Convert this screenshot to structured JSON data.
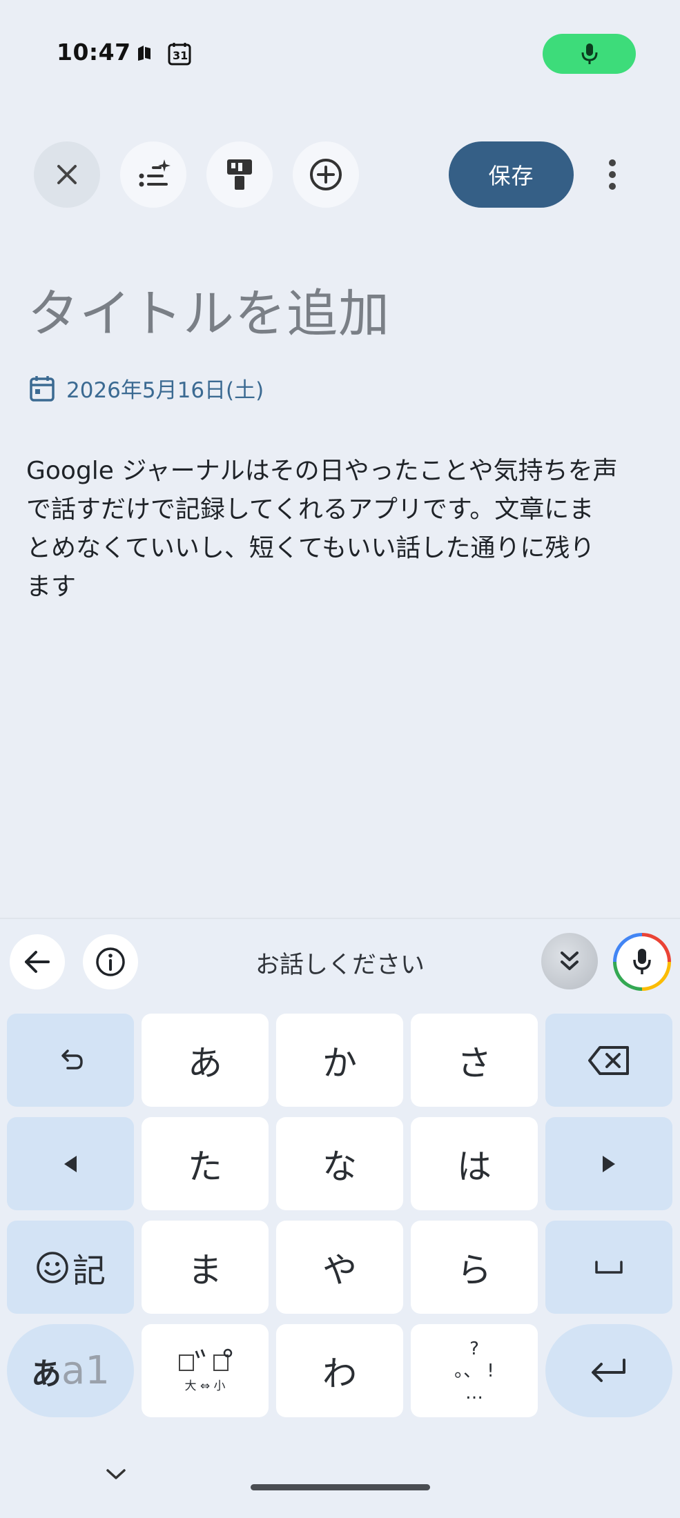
{
  "status_bar": {
    "time": "10:47",
    "calendar_day": "31",
    "mic_indicator_color": "#3ddc7a"
  },
  "toolbar": {
    "close_icon": "close-icon",
    "sparkle_list_icon": "sparkle-list-icon",
    "paint_roller_icon": "paint-roller-icon",
    "add_icon": "add-circle-icon",
    "save_label": "保存",
    "more_icon": "more-vert-icon",
    "save_color": "#355f86"
  },
  "editor": {
    "title_placeholder": "タイトルを追加",
    "date": "2026年5月16日(土)",
    "body": "Google ジャーナルはその日やったことや気持ちを声\nで話すだけで記録してくれるアプリです。文章にま\nとめなくていいし、短くてもいい話した通りに残り\nます"
  },
  "keyboard": {
    "prompt": "お話しください",
    "keys": {
      "a": "あ",
      "ka": "か",
      "sa": "さ",
      "ta": "た",
      "na": "な",
      "ha": "は",
      "ma": "ま",
      "ya": "や",
      "ra": "ら",
      "wa": "わ",
      "emoji_label": "記",
      "mode_kana": "あ",
      "mode_alpha": "a1",
      "dakuten_bottom": "大 ⇔ 小",
      "punct_top": "?",
      "punct_mid": "。、 !",
      "punct_bottom": "…"
    }
  }
}
